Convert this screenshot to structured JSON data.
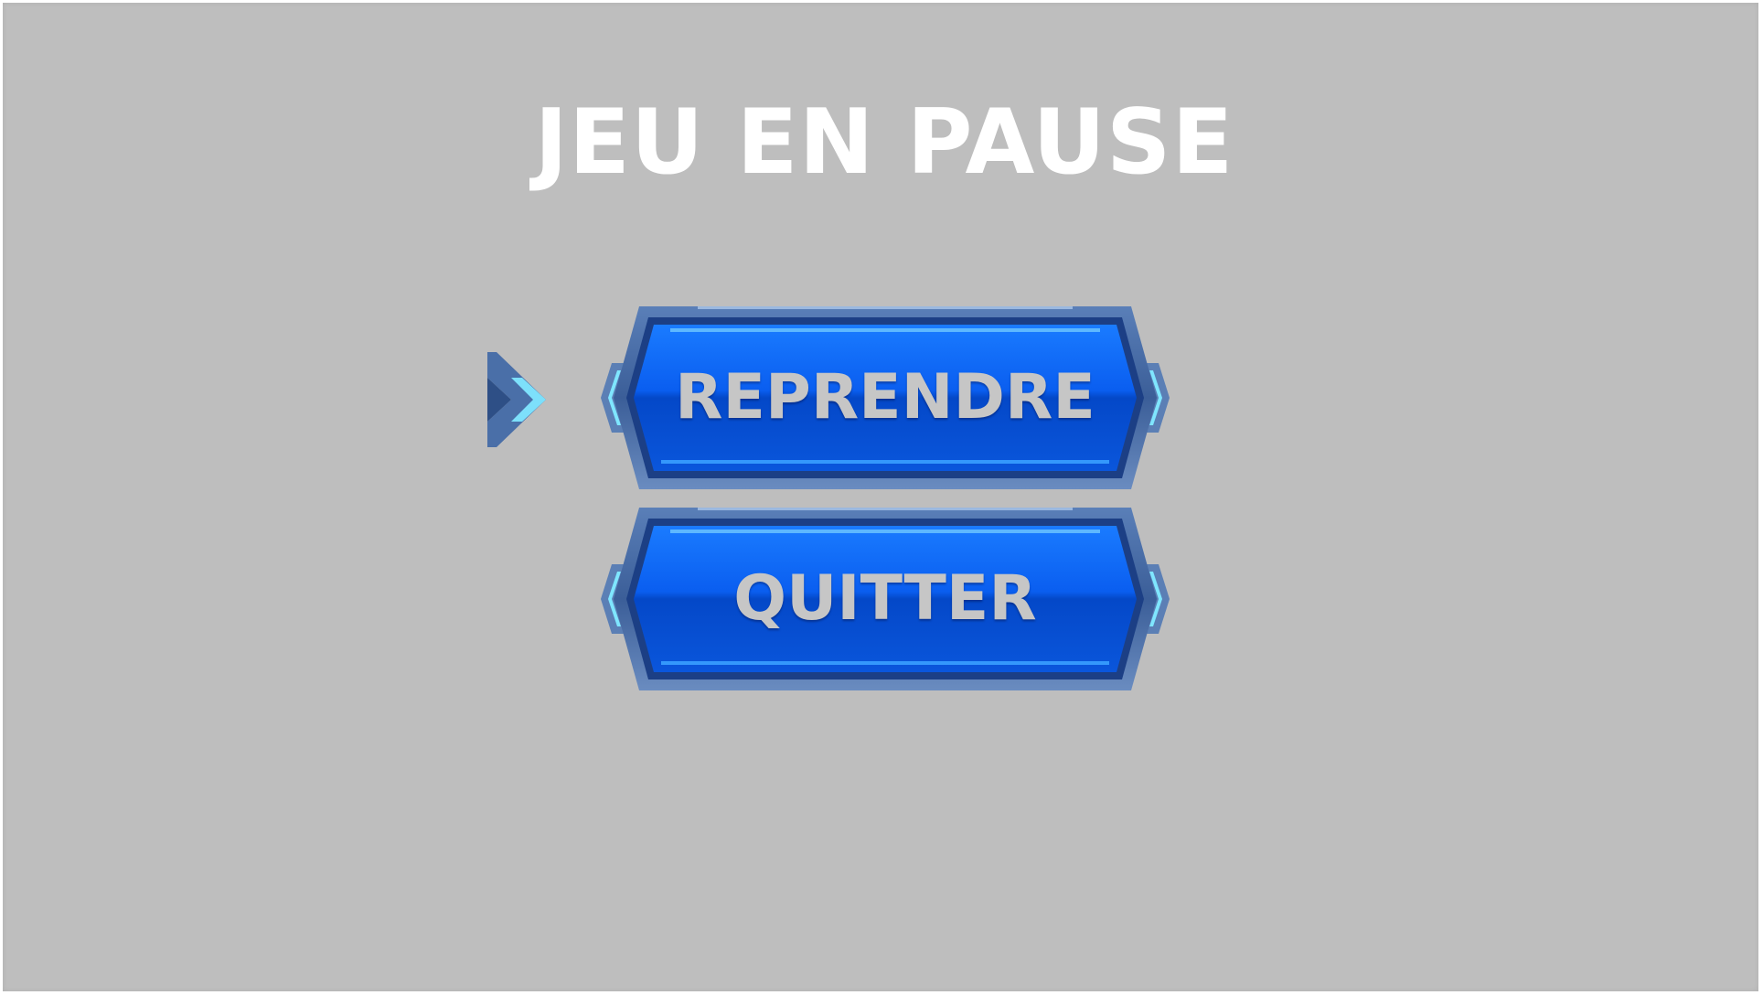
{
  "pause_menu": {
    "title": "JEU EN PAUSE",
    "buttons": [
      {
        "label": "REPRENDRE",
        "selected": true
      },
      {
        "label": "QUITTER",
        "selected": false
      }
    ],
    "selector_icon": "chevron-right-icon"
  },
  "colors": {
    "background": "#bebebe",
    "title": "#ffffff",
    "button_blue": "#0a55e0",
    "button_frame": "#3a5f9a",
    "button_text": "#c6c6c6",
    "accent_cyan": "#7fe6ff"
  }
}
